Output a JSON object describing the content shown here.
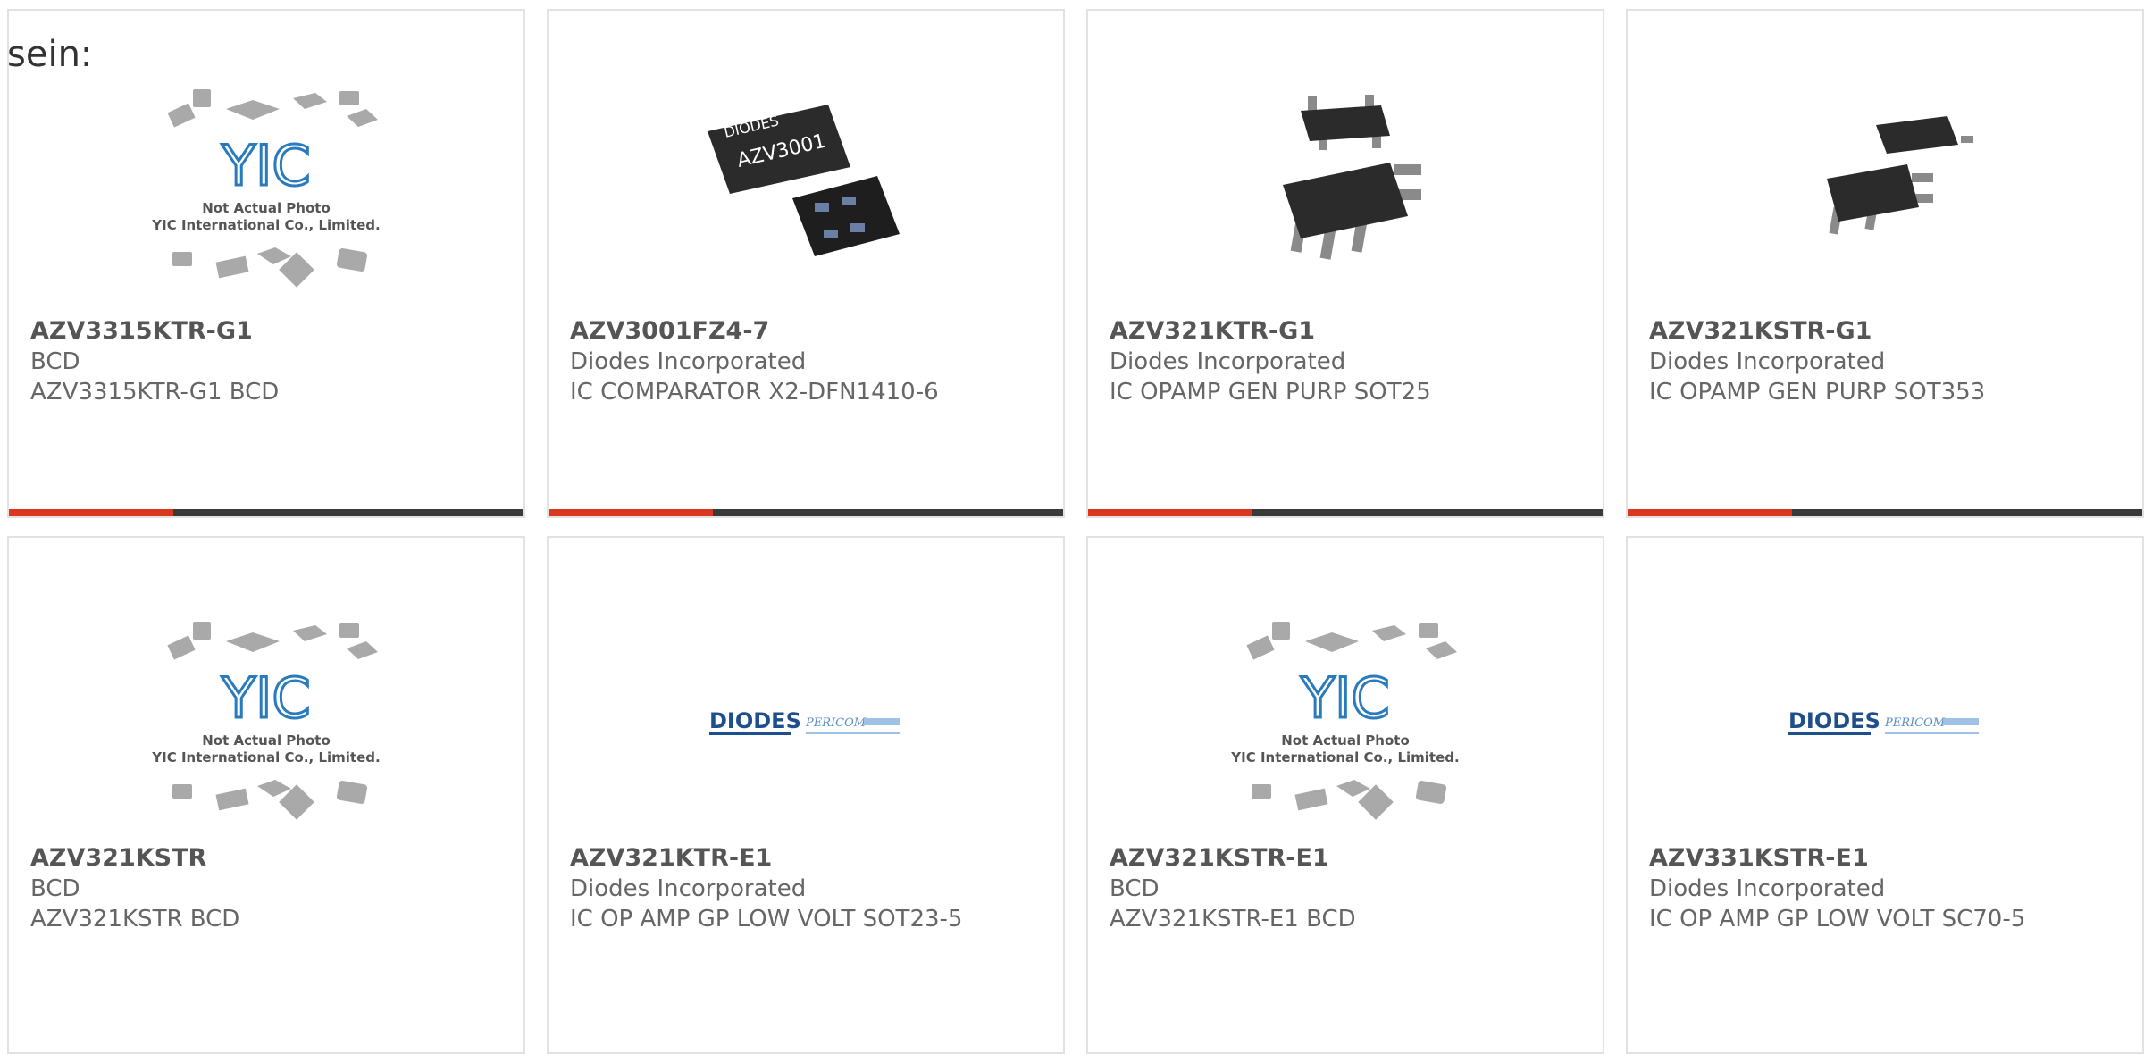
{
  "lead_text": "sein:",
  "colors": {
    "accent": "#d9381e",
    "bar": "#3a3a3a",
    "border": "#e2e2e2",
    "yic_blue": "#2a7bbd",
    "chip": "#2b2b2b",
    "placeholder_gray": "#9a9a9a"
  },
  "placeholder": {
    "line1": "Not Actual Photo",
    "line2": "YIC International Co., Limited.",
    "logo": "YIC"
  },
  "diodes_logo": {
    "brand": "DIODES",
    "sub": "PERICOM"
  },
  "chip_marking": {
    "brand": "DIODES",
    "text": "AZV3001"
  },
  "products": [
    {
      "part": "AZV3315KTR-G1",
      "manufacturer": "BCD",
      "description": "AZV3315KTR-G1 BCD",
      "image": "placeholder"
    },
    {
      "part": "AZV3001FZ4-7",
      "manufacturer": "Diodes Incorporated",
      "description": "IC COMPARATOR X2-DFN1410-6",
      "image": "dfn-chip"
    },
    {
      "part": "AZV321KTR-G1",
      "manufacturer": "Diodes Incorporated",
      "description": "IC OPAMP GEN PURP SOT25",
      "image": "sot-chip"
    },
    {
      "part": "AZV321KSTR-G1",
      "manufacturer": "Diodes Incorporated",
      "description": "IC OPAMP GEN PURP SOT353",
      "image": "sot-chip-small"
    },
    {
      "part": "AZV321KSTR",
      "manufacturer": "BCD",
      "description": "AZV321KSTR BCD",
      "image": "placeholder"
    },
    {
      "part": "AZV321KTR-E1",
      "manufacturer": "Diodes Incorporated",
      "description": "IC OP AMP GP LOW VOLT SOT23-5",
      "image": "diodes-logo"
    },
    {
      "part": "AZV321KSTR-E1",
      "manufacturer": "BCD",
      "description": "AZV321KSTR-E1 BCD",
      "image": "placeholder"
    },
    {
      "part": "AZV331KSTR-E1",
      "manufacturer": "Diodes Incorporated",
      "description": "IC OP AMP GP LOW VOLT SC70-5",
      "image": "diodes-logo"
    }
  ]
}
